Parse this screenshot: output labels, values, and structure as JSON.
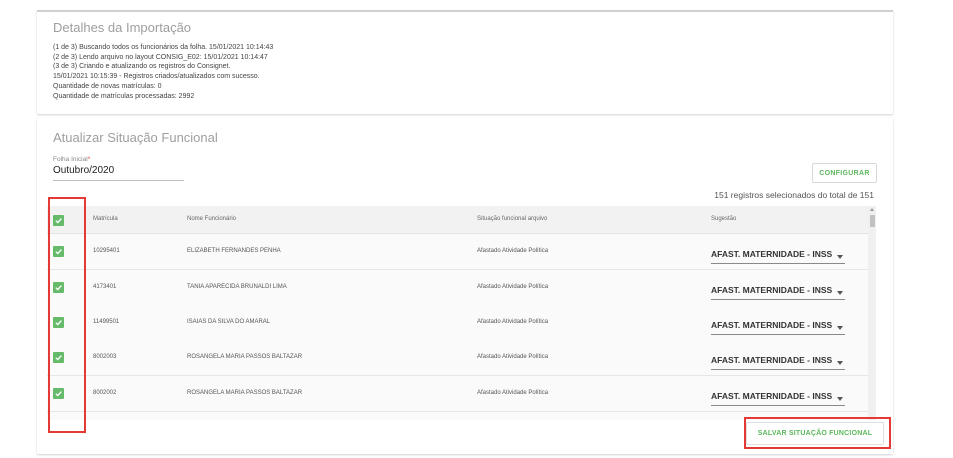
{
  "import_details": {
    "title": "Detalhes da Importação",
    "log": [
      "(1 de 3) Buscando todos os funcionários da folha. 15/01/2021 10:14:43",
      "(2 de 3) Lendo arquivo no layout CONSIG_E02: 15/01/2021 10:14:47",
      "(3 de 3) Criando e atualizando os registros do Consignet.",
      "15/01/2021 10:15:39 - Registros criados/atualizados com sucesso.",
      "Quantidade de novas matrículas: 0",
      "Quantidade de matrículas processadas: 2992"
    ]
  },
  "update_section": {
    "title": "Atualizar Situação Funcional",
    "folha_label": "Folha Inicial",
    "folha_required_mark": "*",
    "folha_value": "Outubro/2020",
    "configure_label": "CONFIGURAR",
    "selected_count_text": "151 registros selecionados do total de 151",
    "save_label": "SALVAR SITUAÇÃO FUNCIONAL"
  },
  "table": {
    "headers": [
      "Matrícula",
      "Nome Funcionário",
      "Situação funcional arquivo",
      "Sugestão"
    ],
    "rows": [
      {
        "checked": true,
        "matricula": "10295401",
        "nome": "ELIZABETH FERNANDES PENHA",
        "situacao": "Afastado Atividade Política",
        "sugestao": "AFAST. MATERNIDADE - INSS"
      },
      {
        "checked": true,
        "matricula": "4173401",
        "nome": "TANIA APARECIDA BRUNALDI LIMA",
        "situacao": "Afastado Atividade Política",
        "sugestao": "AFAST. MATERNIDADE - INSS"
      },
      {
        "checked": true,
        "matricula": "11499501",
        "nome": "ISAIAS DA SILVA DO AMARAL",
        "situacao": "Afastado Atividade Política",
        "sugestao": "AFAST. MATERNIDADE - INSS"
      },
      {
        "checked": true,
        "matricula": "8002003",
        "nome": "ROSANGELA MARIA PASSOS BALTAZAR",
        "situacao": "Afastado Atividade Política",
        "sugestao": "AFAST. MATERNIDADE - INSS"
      },
      {
        "checked": true,
        "matricula": "8002002",
        "nome": "ROSANGELA MARIA PASSOS BALTAZAR",
        "situacao": "Afastado Atividade Política",
        "sugestao": "AFAST. MATERNIDADE - INSS"
      }
    ]
  },
  "colors": {
    "accent_green": "#5cb85c",
    "checkbox_green": "#66bb6a",
    "highlight_red": "#e53935"
  },
  "icons": {
    "checkbox": "check-icon",
    "dropdown": "chevron-down-icon"
  }
}
